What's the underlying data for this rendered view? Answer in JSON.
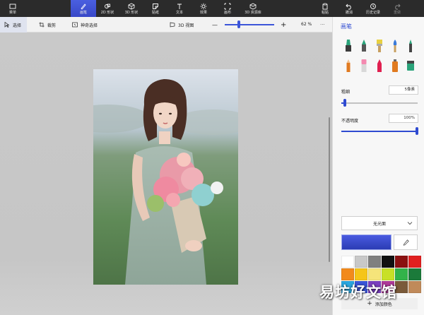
{
  "toolbar": {
    "menu": "菜单",
    "brushes": "画笔",
    "shapes2d": "2D 形状",
    "shapes3d": "3D 形状",
    "stickers": "贴纸",
    "text": "文本",
    "effects": "效果",
    "canvas": "画布",
    "library3d": "3D 资源库",
    "paste": "粘贴",
    "undo": "撤消",
    "history": "历史记录",
    "redo": "重做"
  },
  "subbar": {
    "select": "选择",
    "crop": "裁剪",
    "magic_select": "神奇选择",
    "view3d": "3D 视图",
    "zoom_minus": "—",
    "zoom_plus": "+",
    "zoom": "62 %",
    "more": "···"
  },
  "panel": {
    "title": "画笔",
    "thickness_label": "粗细",
    "thickness_value": "5像素",
    "opacity_label": "不透明度",
    "opacity_value": "100%",
    "finish": "无光面",
    "add_color": "添加颜色",
    "add_icon": "+"
  },
  "watermark": "易坊好文馆",
  "colors": {
    "accent": "#3b55d9",
    "palette": [
      "#ffffff",
      "#c8c8c8",
      "#7f7f7f",
      "#111111",
      "#8a1010",
      "#e01f1f",
      "#f28a1c",
      "#f5c518",
      "#f5e47a",
      "#c8e026",
      "#32b34a",
      "#1b7a3a",
      "#2aa7e0",
      "#3b55d9",
      "#7a3fbf",
      "#b03a9a",
      "#7a5a3a",
      "#c08a5a"
    ]
  }
}
